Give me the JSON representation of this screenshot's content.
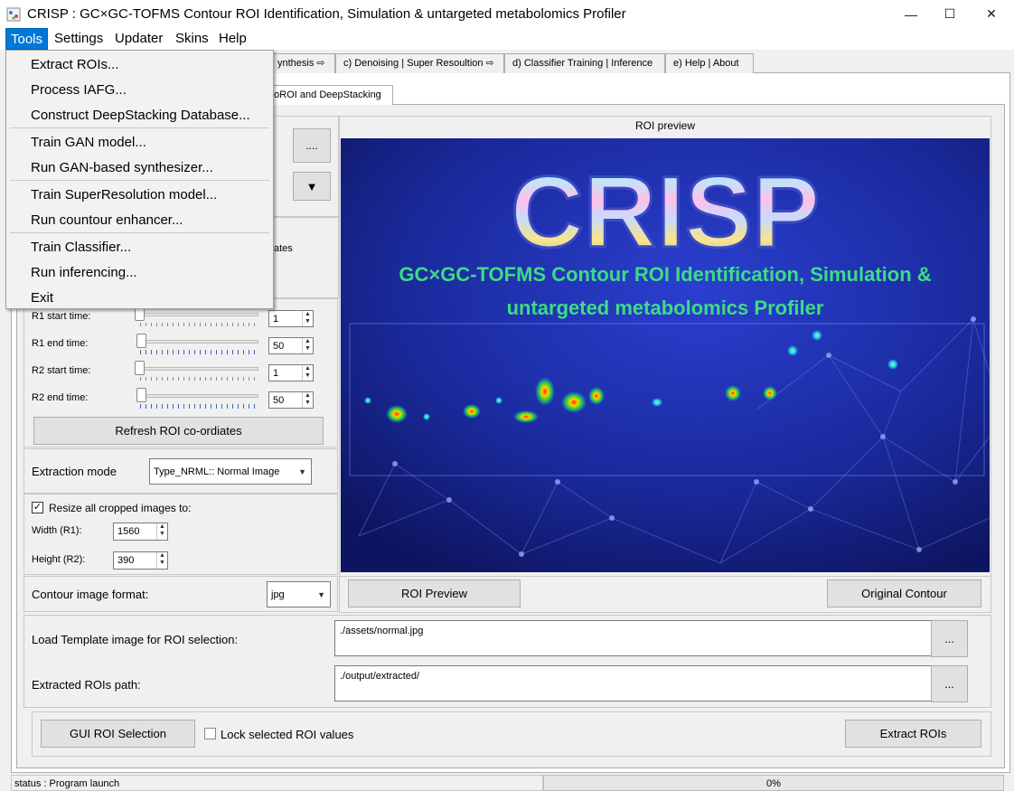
{
  "window": {
    "title": "CRISP : GC×GC-TOFMS Contour ROI Identification, Simulation & untargeted metabolomics Profiler",
    "minimize": "—",
    "maximize": "☐",
    "close": "✕"
  },
  "menubar": {
    "tools": "Tools",
    "settings": "Settings",
    "updater": "Updater",
    "skins": "Skins",
    "help": "Help"
  },
  "tools_menu": {
    "extract_rois": "Extract ROIs...",
    "process_iafg": "Process IAFG...",
    "construct_db": "Construct DeepStacking Database...",
    "train_gan": "Train GAN model...",
    "run_gan": "Run GAN-based synthesizer...",
    "train_sr": "Train SuperResolution model...",
    "run_enhancer": "Run countour enhancer...",
    "train_classifier": "Train Classifier...",
    "run_inferencing": "Run inferencing...",
    "exit": "Exit"
  },
  "tabs": {
    "b": "ynthesis ⇨",
    "c": "c) Denoising | Super Resoultion ⇨",
    "d": "d) Classifier Training | Inference",
    "e": "e) Help | About",
    "sub": "utoROI and DeepStacking"
  },
  "left": {
    "browse": "....",
    "combo_arrow": "▼",
    "partial_text": "ates",
    "r1_start_label": "R1 start time:",
    "r1_start_value": "1",
    "r1_end_label": "R1 end time:",
    "r1_end_value": "50",
    "r2_start_label": "R2 start time:",
    "r2_start_value": "1",
    "r2_end_label": "R2 end time:",
    "r2_end_value": "50",
    "refresh_button": "Refresh ROI co-ordiates",
    "extraction_mode_label": "Extraction mode",
    "extraction_mode_value": "Type_NRML:: Normal Image",
    "resize_checked": "✓",
    "resize_label": "Resize all cropped images to:",
    "width_label": "Width (R1):",
    "width_value": "1560",
    "height_label": "Height (R2):",
    "height_value": "390",
    "format_label": "Contour image format:",
    "format_value": "jpg"
  },
  "preview": {
    "title": "ROI preview",
    "logo_text": "CRISP",
    "tagline_line1": "GC×GC-TOFMS Contour ROI Identification, Simulation &",
    "tagline_line2": "untargeted metabolomics Profiler",
    "roi_preview_button": "ROI Preview",
    "original_contour_button": "Original Contour"
  },
  "bottom": {
    "template_label": "Load Template image for ROI selection:",
    "template_value": "./assets/normal.jpg",
    "extracted_label": "Extracted ROIs path:",
    "extracted_value": "./output/extracted/",
    "browse": "...",
    "gui_selection_button": "GUI ROI Selection",
    "lock_label": "Lock selected ROI values",
    "extract_button": "Extract ROIs"
  },
  "status": {
    "text": "status : Program launch",
    "progress": "0%"
  },
  "colors": {
    "menu_highlight": "#0078d7",
    "preview_bg": "#1a2a9c",
    "logo_green": "#3ddc84"
  }
}
